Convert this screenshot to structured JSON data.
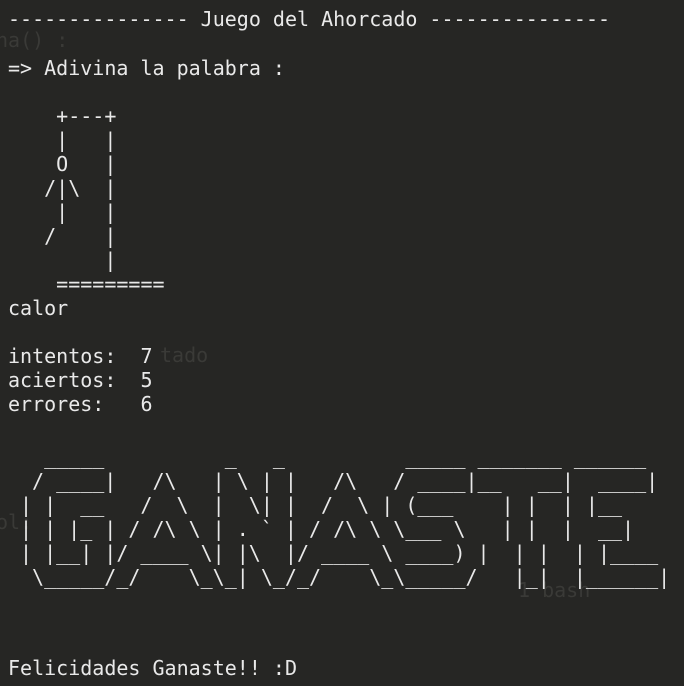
{
  "title_line": "--------------- Juego del Ahorcado ---------------",
  "prompt": "=> Adivina la palabra :",
  "gallows": {
    "lines": [
      "    +---+",
      "    |   |",
      "    O   |",
      "   /|\\  |",
      "    |   |",
      "   /    |",
      "        |",
      "    ========="
    ]
  },
  "word": "calor",
  "stats": {
    "intentos": "intentos:  7",
    "aciertos": "aciertos:  5",
    "errores": "errores:   6"
  },
  "banner": {
    "lines": [
      "  _____          _   _          _____ _______ ______ ",
      " / ____|   /\\   | \\ | |   /\\   / ____|__   __|  ____|",
      "| |  __   /  \\  |  \\| |  /  \\ | (___    | |  | |__   ",
      "| | |_ | / /\\ \\ | . ` | / /\\ \\ \\___ \\   | |  |  __|  ",
      "| |__| |/ ____ \\| |\\  |/ ____ \\ ____) |  | |  | |____ ",
      " \\_____/_/    \\_\\_| \\_/_/    \\_\\_____/   |_|  |______|"
    ]
  },
  "footer": "Felicidades Ganaste!! :D",
  "ghost_text": {
    "top_left": "na() :",
    "mid": "tado",
    "left": "ol:",
    "bash": "1 bash"
  },
  "colors": {
    "background": "#262624",
    "text": "#e9e9e9",
    "ghost": "#3a3a37"
  }
}
